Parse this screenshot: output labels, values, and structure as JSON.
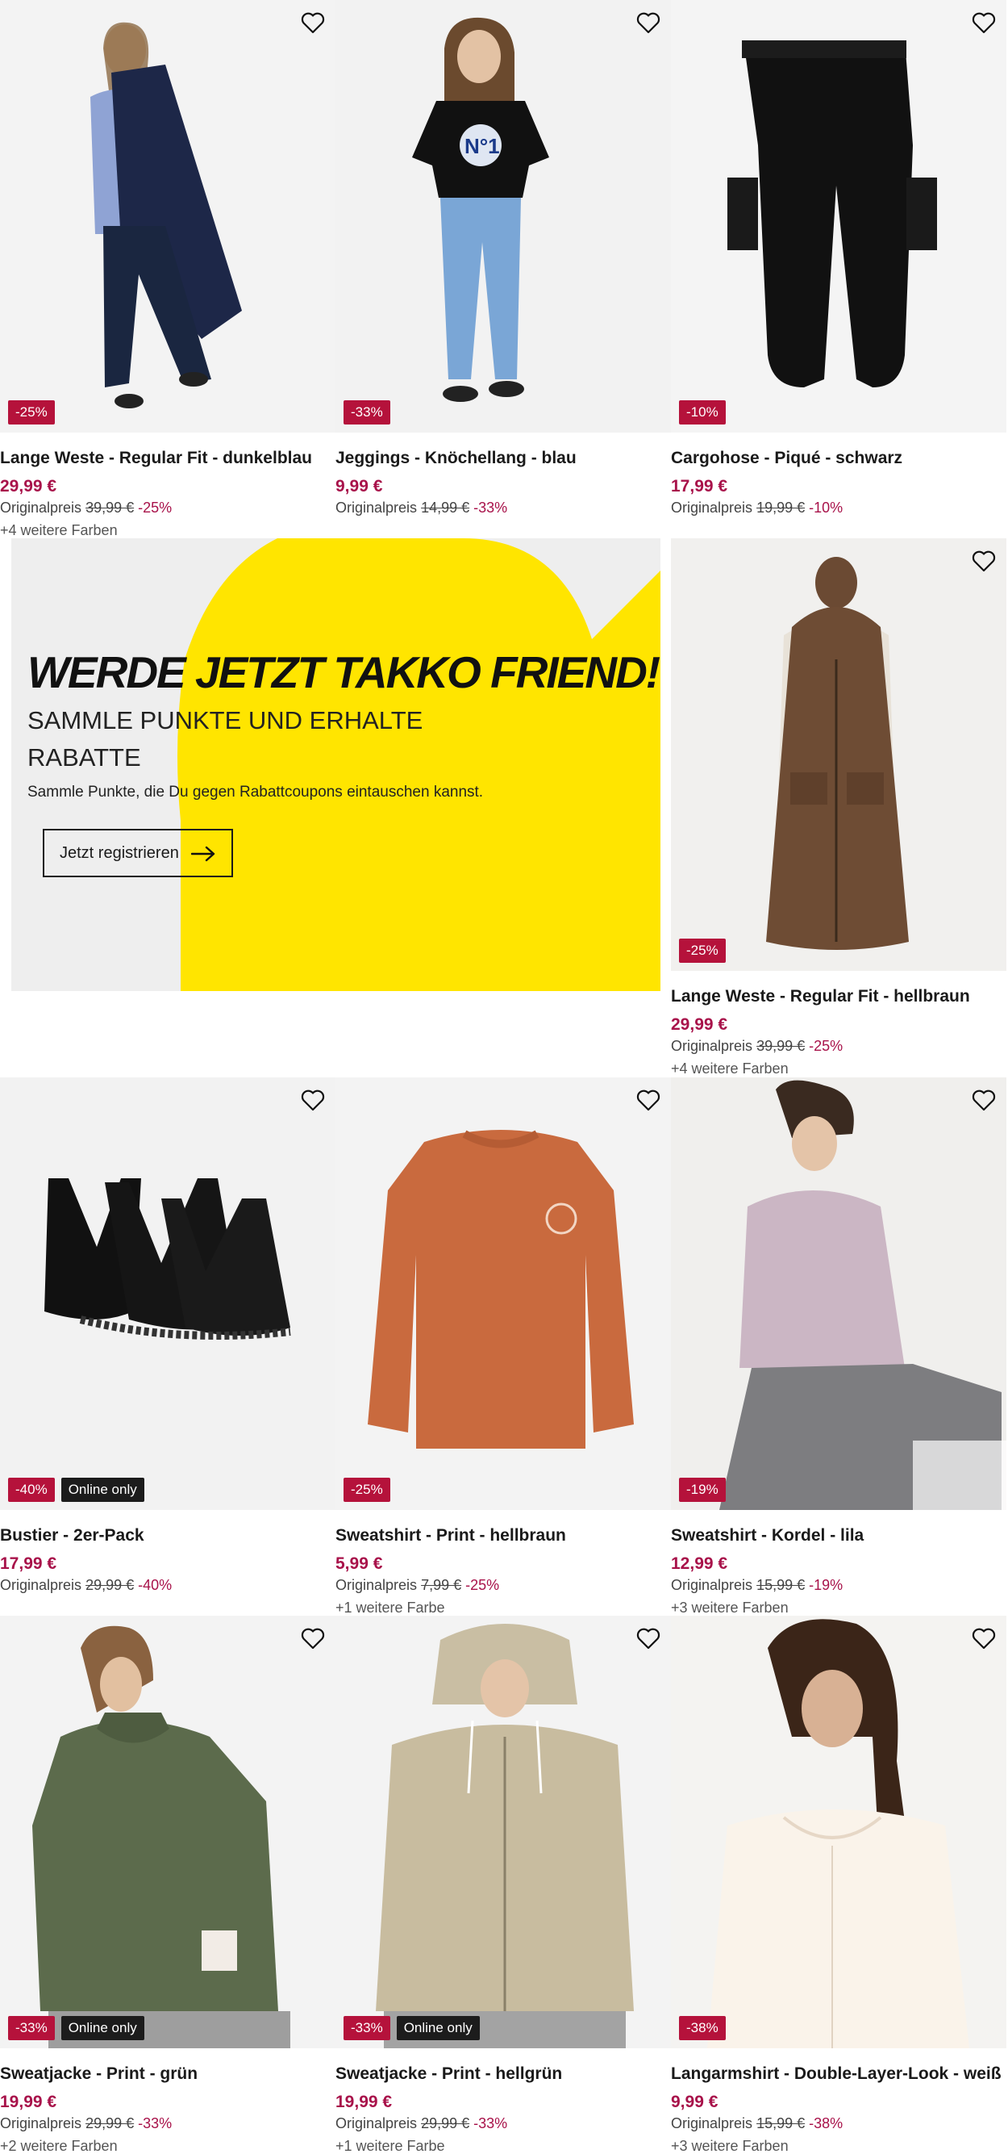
{
  "icons": {
    "favorite": "heart-outline-icon",
    "cta_arrow": "arrow-right-icon"
  },
  "colors": {
    "sale_badge": "#b5123b",
    "price": "#a8124a",
    "online_badge": "#1c1c1c",
    "promo_yellow": "#ffe500",
    "promo_bg": "#eeeeee"
  },
  "products": [
    {
      "title": "Lange Weste - Regular Fit - dunkelblau",
      "price": "29,99 €",
      "orig_label": "Originalpreis",
      "orig_price": "39,99 €",
      "orig_discount": "-25%",
      "badge": "-25%",
      "online": "",
      "colors": "+4 weitere Farben"
    },
    {
      "title": "Jeggings - Knöchellang - blau",
      "price": "9,99 €",
      "orig_label": "Originalpreis",
      "orig_price": "14,99 €",
      "orig_discount": "-33%",
      "badge": "-33%",
      "online": "",
      "colors": ""
    },
    {
      "title": "Cargohose - Piqué - schwarz",
      "price": "17,99 €",
      "orig_label": "Originalpreis",
      "orig_price": "19,99 €",
      "orig_discount": "-10%",
      "badge": "-10%",
      "online": "",
      "colors": ""
    },
    {
      "title": "Lange Weste - Regular Fit - hellbraun",
      "price": "29,99 €",
      "orig_label": "Originalpreis",
      "orig_price": "39,99 €",
      "orig_discount": "-25%",
      "badge": "-25%",
      "online": "",
      "colors": "+4 weitere Farben"
    },
    {
      "title": "Bustier - 2er-Pack",
      "price": "17,99 €",
      "orig_label": "Originalpreis",
      "orig_price": "29,99 €",
      "orig_discount": "-40%",
      "badge": "-40%",
      "online": "Online only",
      "colors": ""
    },
    {
      "title": "Sweatshirt - Print - hellbraun",
      "price": "5,99 €",
      "orig_label": "Originalpreis",
      "orig_price": "7,99 €",
      "orig_discount": "-25%",
      "badge": "-25%",
      "online": "",
      "colors": "+1 weitere Farbe"
    },
    {
      "title": "Sweatshirt - Kordel - lila",
      "price": "12,99 €",
      "orig_label": "Originalpreis",
      "orig_price": "15,99 €",
      "orig_discount": "-19%",
      "badge": "-19%",
      "online": "",
      "colors": "+3 weitere Farben"
    },
    {
      "title": "Sweatjacke - Print - grün",
      "price": "19,99 €",
      "orig_label": "Originalpreis",
      "orig_price": "29,99 €",
      "orig_discount": "-33%",
      "badge": "-33%",
      "online": "Online only",
      "colors": "+2 weitere Farben"
    },
    {
      "title": "Sweatjacke - Print - hellgrün",
      "price": "19,99 €",
      "orig_label": "Originalpreis",
      "orig_price": "29,99 €",
      "orig_discount": "-33%",
      "badge": "-33%",
      "online": "Online only",
      "colors": "+1 weitere Farbe"
    },
    {
      "title": "Langarmshirt - Double-Layer-Look - weiß",
      "price": "9,99 €",
      "orig_label": "Originalpreis",
      "orig_price": "15,99 €",
      "orig_discount": "-38%",
      "badge": "-38%",
      "online": "",
      "colors": "+3 weitere Farben"
    }
  ],
  "promo": {
    "headline_part1": "WERDE ",
    "headline_part2": "JETZT TAKKO FRIEND!",
    "subline": "SAMMLE PUNKTE UND ERHALTE RABATTE",
    "description": "Sammle Punkte, die Du gegen Rabattcoupons eintauschen kannst.",
    "cta_label": "Jetzt registrieren"
  }
}
